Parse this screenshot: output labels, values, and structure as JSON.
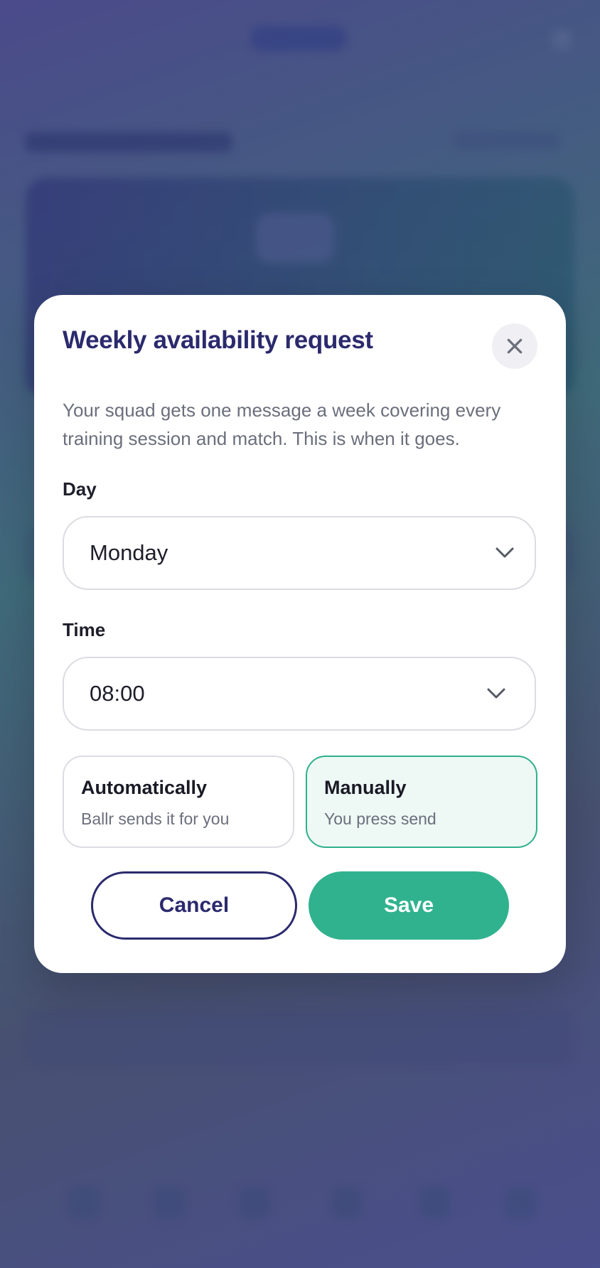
{
  "modal": {
    "title": "Weekly availability request",
    "description": "Your squad gets one message a week covering every training session and match. This is when it goes.",
    "day": {
      "label": "Day",
      "value": "Monday"
    },
    "time": {
      "label": "Time",
      "value": "08:00"
    },
    "send_options": [
      {
        "title": "Automatically",
        "subtitle": "Ballr sends it for you",
        "selected": false
      },
      {
        "title": "Manually",
        "subtitle": "You press send",
        "selected": true
      }
    ],
    "cancel_label": "Cancel",
    "save_label": "Save"
  },
  "icons": {
    "close": "close-icon",
    "dropdown": "chevron-down-icon"
  },
  "colors": {
    "title": "#2b2a6e",
    "accent": "#31b28f",
    "selected_bg": "#eef8f4",
    "border": "#dcdce2"
  }
}
